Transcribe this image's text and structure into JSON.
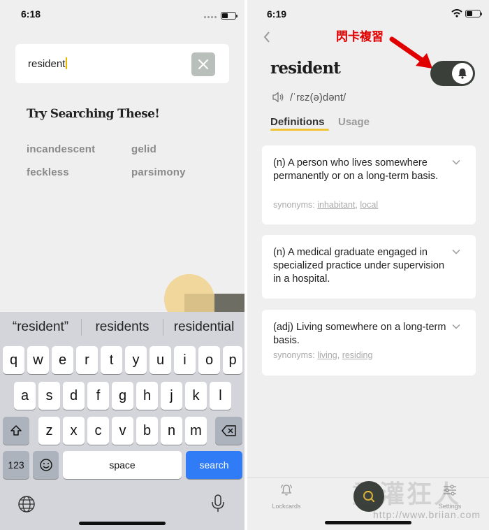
{
  "left_screen": {
    "status_time": "6:18",
    "search": {
      "value": "resident"
    },
    "try_heading": "Try Searching These!",
    "suggestions": [
      "incandescent",
      "gelid",
      "feckless",
      "parsimony"
    ],
    "keyboard": {
      "predictions": [
        "“resident”",
        "residents",
        "residential"
      ],
      "row1": [
        "q",
        "w",
        "e",
        "r",
        "t",
        "y",
        "u",
        "i",
        "o",
        "p"
      ],
      "row2": [
        "a",
        "s",
        "d",
        "f",
        "g",
        "h",
        "j",
        "k",
        "l"
      ],
      "row3": [
        "z",
        "x",
        "c",
        "v",
        "b",
        "n",
        "m"
      ],
      "numbers_key": "123",
      "space_key": "space",
      "search_key": "search"
    }
  },
  "right_screen": {
    "status_time": "6:19",
    "annotation": "閃卡複習",
    "word": "resident",
    "pronunciation": "/ˈrɛz(ə)dənt/",
    "tabs": [
      "Definitions",
      "Usage"
    ],
    "definitions": [
      {
        "text": "(n) A person who lives somewhere permanently or on a long-term basis.",
        "synonyms_label": "synonyms:",
        "synonyms": [
          "inhabitant",
          "local"
        ]
      },
      {
        "text": "(n) A medical graduate engaged in specialized practice under supervision in a hospital."
      },
      {
        "text": "(adj) Living somewhere on a long-term basis.",
        "synonyms_label": "synonyms:",
        "synonyms": [
          "living",
          "residing"
        ]
      }
    ],
    "tabbar": {
      "lockcards": "Lockcards",
      "settings": "Settings"
    },
    "watermark": "重灌狂人",
    "watermark_url": "http://www.briian.com"
  },
  "colors": {
    "accent_yellow": "#f0c338",
    "toggle_dark": "#3a3f3a",
    "search_blue": "#2f7cf6",
    "annotation_red": "#e00000"
  }
}
